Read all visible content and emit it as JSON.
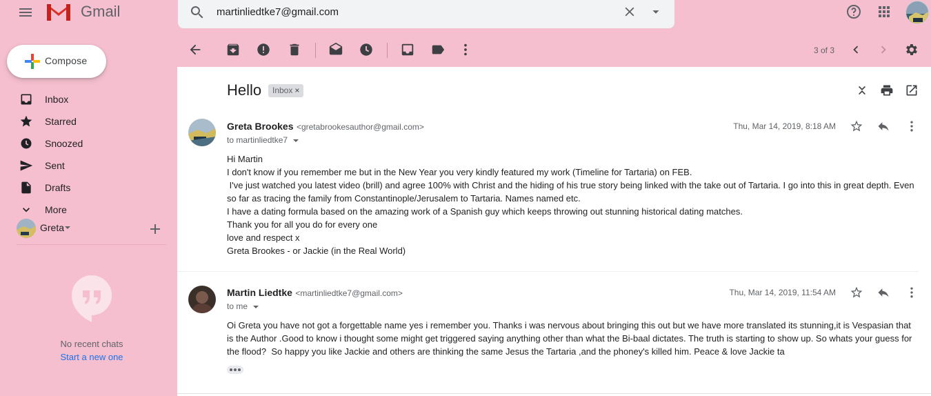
{
  "app": {
    "brand": "Gmail",
    "colors": {
      "background": "#f6bfcf",
      "link": "#1a73e8",
      "content_bg": "#ffffff"
    }
  },
  "header": {
    "search_value": "martinliedtke7@gmail.com",
    "icons": [
      "menu-icon",
      "gmail-logo",
      "search-icon",
      "clear-search-icon",
      "search-options-icon",
      "help-icon",
      "apps-icon",
      "account-avatar"
    ]
  },
  "sidebar": {
    "compose_label": "Compose",
    "items": [
      {
        "label": "Inbox",
        "icon": "inbox-icon"
      },
      {
        "label": "Starred",
        "icon": "star-icon"
      },
      {
        "label": "Snoozed",
        "icon": "clock-icon"
      },
      {
        "label": "Sent",
        "icon": "send-icon"
      },
      {
        "label": "Drafts",
        "icon": "draft-icon"
      },
      {
        "label": "More",
        "icon": "chevron-down-icon"
      }
    ],
    "hangouts": {
      "user": "Greta",
      "no_chats": "No recent chats",
      "start_new": "Start a new one"
    }
  },
  "toolbar": {
    "icons": [
      "back-icon",
      "archive-icon",
      "report-spam-icon",
      "delete-icon",
      "mark-unread-icon",
      "snooze-icon",
      "add-to-tasks-icon",
      "label-icon",
      "more-vert-icon",
      "prev-icon",
      "next-icon",
      "settings-icon"
    ],
    "page_count": "3 of 3"
  },
  "thread": {
    "subject": "Hello",
    "label": "Inbox",
    "label_close": "×",
    "messages": [
      {
        "sender": "Greta Brookes",
        "email": "<gretabrookesauthor@gmail.com>",
        "to": "to martinliedtke7",
        "date": "Thu, Mar 14, 2019, 8:18 AM",
        "lines": [
          "Hi Martin",
          "I don't know if you remember me but in the New Year you very kindly featured my work (Timeline for Tartaria) on FEB.",
          " I've just watched you latest video (brill) and agree 100% with Christ and the hiding of his true story being linked with the take out of Tartaria. I go into this in great depth. Even",
          "so far as tracing the family from Constantinople/Jerusalem to Tartaria. Names named etc.",
          "I have a dating formula based on the amazing work of a Spanish guy which keeps throwing out stunning historical dating matches.",
          "Thank you for all you do for every one",
          "love and respect x",
          "Greta Brookes - or Jackie (in the Real World)"
        ]
      },
      {
        "sender": "Martin Liedtke",
        "email": "<martinliedtke7@gmail.com>",
        "to": "to me",
        "date": "Thu, Mar 14, 2019, 11:54 AM",
        "lines": [
          "Oi Greta you have not got a forgettable name yes i remember you. Thanks i was nervous about bringing this out but we have more translated its stunning,it is Vespasian that",
          "is the Author .Good to know i thought some might get triggered saying anything other than what the Bi-baal dictates. The truth is starting to show up. So whats your guess for",
          "the flood?  So happy you like Jackie and others are thinking the same Jesus the Tartaria ,and the phoney's killed him. Peace & love Jackie ta"
        ]
      }
    ]
  }
}
